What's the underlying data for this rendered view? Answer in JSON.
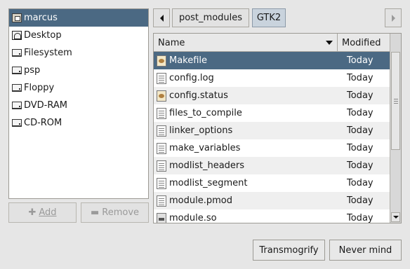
{
  "places": {
    "items": [
      {
        "label": "marcus",
        "icon": "home-folder-icon",
        "selected": true
      },
      {
        "label": "Desktop",
        "icon": "desktop-icon",
        "selected": false
      },
      {
        "label": "Filesystem",
        "icon": "drive-icon",
        "selected": false
      },
      {
        "label": "psp",
        "icon": "drive-icon",
        "selected": false
      },
      {
        "label": "Floppy",
        "icon": "drive-icon",
        "selected": false
      },
      {
        "label": "DVD-RAM",
        "icon": "drive-icon",
        "selected": false
      },
      {
        "label": "CD-ROM",
        "icon": "drive-icon",
        "selected": false
      }
    ],
    "add_label": "Add",
    "remove_label": "Remove"
  },
  "pathbar": {
    "crumbs": [
      "post_modules",
      "GTK2"
    ],
    "active": "GTK2"
  },
  "file_list": {
    "columns": {
      "name": "Name",
      "modified": "Modified"
    },
    "sort": "name-descending",
    "rows": [
      {
        "name": "Makefile",
        "modified": "Today",
        "icon": "makefile-icon",
        "selected": true
      },
      {
        "name": "config.log",
        "modified": "Today",
        "icon": "text-file-icon"
      },
      {
        "name": "config.status",
        "modified": "Today",
        "icon": "script-file-icon"
      },
      {
        "name": "files_to_compile",
        "modified": "Today",
        "icon": "text-file-icon"
      },
      {
        "name": "linker_options",
        "modified": "Today",
        "icon": "text-file-icon"
      },
      {
        "name": "make_variables",
        "modified": "Today",
        "icon": "text-file-icon"
      },
      {
        "name": "modlist_headers",
        "modified": "Today",
        "icon": "text-file-icon"
      },
      {
        "name": "modlist_segment",
        "modified": "Today",
        "icon": "text-file-icon"
      },
      {
        "name": "module.pmod",
        "modified": "Today",
        "icon": "text-file-icon"
      },
      {
        "name": "module.so",
        "modified": "Today",
        "icon": "library-file-icon"
      }
    ]
  },
  "buttons": {
    "ok_label": "Transmogrify",
    "cancel_label": "Never mind"
  },
  "colors": {
    "selection": "#4b6983",
    "background": "#e6e6e6"
  }
}
